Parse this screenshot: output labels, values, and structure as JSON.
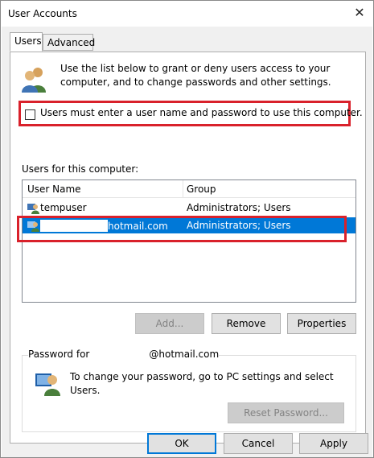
{
  "window": {
    "title": "User Accounts",
    "close_glyph": "✕"
  },
  "tabs": [
    {
      "label": "Users",
      "active": true
    },
    {
      "label": "Advanced",
      "active": false
    }
  ],
  "users_tab": {
    "intro": "Use the list below to grant or deny users access to your computer, and to change passwords and other settings.",
    "require_password_checkbox": {
      "label": "Users must enter a user name and password to use this computer.",
      "checked": false
    },
    "list_label": "Users for this computer:",
    "columns": {
      "name": "User Name",
      "group": "Group"
    },
    "rows": [
      {
        "name": "tempuser",
        "group": "Administrators; Users",
        "selected": false
      },
      {
        "name": "hotmail.com",
        "group": "Administrators; Users",
        "selected": true
      }
    ],
    "buttons": {
      "add": "Add...",
      "remove": "Remove",
      "properties": "Properties"
    },
    "password_group": {
      "title_prefix": "Password for",
      "title_suffix": "@hotmail.com",
      "text": "To change your password, go to PC settings and select Users.",
      "reset_button": "Reset Password..."
    }
  },
  "dialog_buttons": {
    "ok": "OK",
    "cancel": "Cancel",
    "apply": "Apply"
  },
  "colors": {
    "highlight_border": "#d9212b",
    "selection": "#0078d7"
  },
  "icons": {
    "users_icon": "users-icon",
    "user_row_icon": "user-account-icon",
    "password_icon": "password-user-icon"
  }
}
